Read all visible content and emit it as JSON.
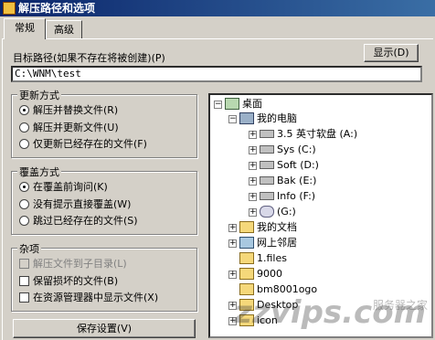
{
  "window": {
    "title": "解压路径和选项"
  },
  "tabs": [
    "常规",
    "高级"
  ],
  "target": {
    "label": "目标路径(如果不存在将被创建)(P)",
    "value": "C:\\WNM\\test",
    "show_button": "显示(D)"
  },
  "update_mode": {
    "title": "更新方式",
    "options": [
      "解压并替换文件(R)",
      "解压并更新文件(U)",
      "仅更新已经存在的文件(F)"
    ]
  },
  "overwrite_mode": {
    "title": "覆盖方式",
    "options": [
      "在覆盖前询问(K)",
      "没有提示直接覆盖(W)",
      "跳过已经存在的文件(S)"
    ]
  },
  "misc": {
    "title": "杂项",
    "options": [
      "解压文件到子目录(L)",
      "保留损坏的文件(B)",
      "在资源管理器中显示文件(X)"
    ]
  },
  "save_button": "保存设置(V)",
  "tree": {
    "root": "桌面",
    "my_computer": "我的电脑",
    "drives": [
      "3.5 英寸软盘 (A:)",
      "Sys (C:)",
      "Soft (D:)",
      "Bak (E:)",
      "Info (F:)",
      "(G:)"
    ],
    "my_documents": "我的文档",
    "network": "网上邻居",
    "folders": [
      "1.files",
      "9000",
      "bm8001ogo",
      "Desktop",
      "icon"
    ]
  },
  "watermark": {
    "text": "zzvips.com",
    "sub": "服务器之家"
  }
}
